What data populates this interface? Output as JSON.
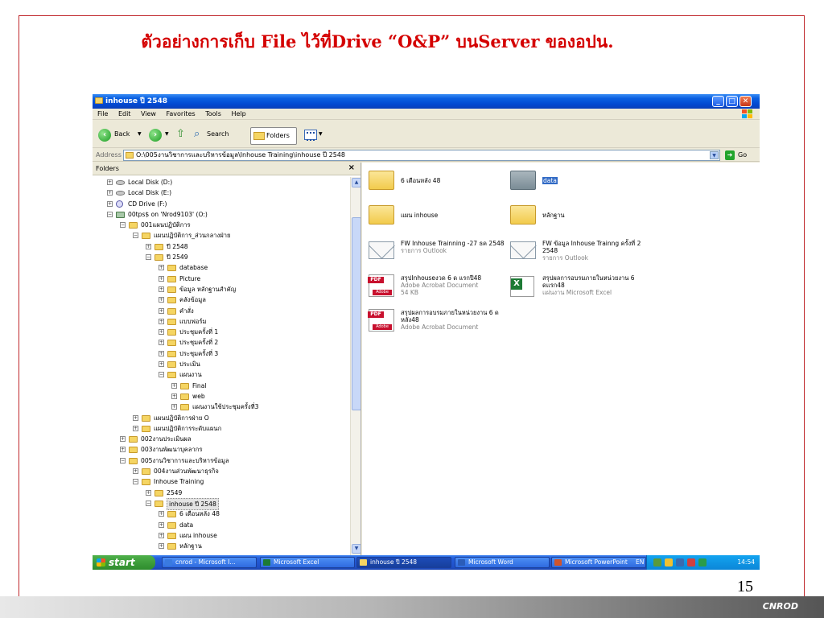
{
  "slide": {
    "title": "ตัวอย่างการเก็บ File ไว้ที่Drive “O&P” บนServer ของอปน.",
    "page_number": "15",
    "brand": "CNROD"
  },
  "window": {
    "title": "inhouse ปี 2548",
    "menu": [
      "File",
      "Edit",
      "View",
      "Favorites",
      "Tools",
      "Help"
    ],
    "toolbar": {
      "back": "Back",
      "search": "Search",
      "folders": "Folders"
    },
    "address": {
      "label": "Address",
      "value": "O:\\005งานวิชาการและบริหารข้อมูล\\Inhouse Training\\inhouse ปี 2548",
      "go": "Go"
    }
  },
  "folders_pane": {
    "header": "Folders",
    "close": "×",
    "items": [
      {
        "label": "Local Disk (D:)",
        "level": 1,
        "exp": "+",
        "icon": "disk-icon"
      },
      {
        "label": "Local Disk (E:)",
        "level": 1,
        "exp": "+",
        "icon": "disk-icon"
      },
      {
        "label": "CD Drive (F:)",
        "level": 1,
        "exp": "+",
        "icon": "cd-icon"
      },
      {
        "label": "00tps$ on 'Nrod9103' (O:)",
        "level": 1,
        "exp": "−",
        "icon": "network-drive-icon"
      },
      {
        "label": "001แผนปฏิบัติการ",
        "level": 2,
        "exp": "−",
        "icon": "folder-icon"
      },
      {
        "label": "แผนปฏิบัติการ_ส่วนกลางฝ่าย",
        "level": 3,
        "exp": "−",
        "icon": "folder-icon"
      },
      {
        "label": "ปี 2548",
        "level": 4,
        "exp": "+",
        "icon": "folder-icon"
      },
      {
        "label": "ปี 2549",
        "level": 4,
        "exp": "−",
        "icon": "folder-icon"
      },
      {
        "label": "database",
        "level": 5,
        "exp": "+",
        "icon": "folder-icon"
      },
      {
        "label": "Picture",
        "level": 5,
        "exp": "+",
        "icon": "folder-icon"
      },
      {
        "label": "ข้อมูล หลักฐานสำคัญ",
        "level": 5,
        "exp": "+",
        "icon": "folder-icon"
      },
      {
        "label": "คลังข้อมูล",
        "level": 5,
        "exp": "+",
        "icon": "folder-icon"
      },
      {
        "label": "คำสั่ง",
        "level": 5,
        "exp": "+",
        "icon": "folder-icon"
      },
      {
        "label": "แบบฟอร์ม",
        "level": 5,
        "exp": "+",
        "icon": "folder-icon"
      },
      {
        "label": "ประชุมครั้งที่ 1",
        "level": 5,
        "exp": "+",
        "icon": "folder-icon"
      },
      {
        "label": "ประชุมครั้งที่ 2",
        "level": 5,
        "exp": "+",
        "icon": "folder-icon"
      },
      {
        "label": "ประชุมครั้งที่ 3",
        "level": 5,
        "exp": "+",
        "icon": "folder-icon"
      },
      {
        "label": "ประเมิน",
        "level": 5,
        "exp": "+",
        "icon": "folder-icon"
      },
      {
        "label": "แผนงาน",
        "level": 5,
        "exp": "−",
        "icon": "folder-icon"
      },
      {
        "label": "Final",
        "level": 6,
        "exp": "+",
        "icon": "folder-icon"
      },
      {
        "label": "web",
        "level": 6,
        "exp": "+",
        "icon": "folder-icon"
      },
      {
        "label": "แผนงานใช้ประชุมครั้งที่3",
        "level": 6,
        "exp": "+",
        "icon": "folder-icon"
      },
      {
        "label": "แผนปฏิบัติการฝ่าย O",
        "level": 3,
        "exp": "+",
        "icon": "folder-icon"
      },
      {
        "label": "แผนปฏิบัติการระดับแผนก",
        "level": 3,
        "exp": "+",
        "icon": "folder-icon"
      },
      {
        "label": "002งานประเมินผล",
        "level": 2,
        "exp": "+",
        "icon": "folder-icon"
      },
      {
        "label": "003งานพัฒนาบุคลากร",
        "level": 2,
        "exp": "+",
        "icon": "folder-icon"
      },
      {
        "label": "005งานวิชาการและบริหารข้อมูล",
        "level": 2,
        "exp": "−",
        "icon": "folder-icon"
      },
      {
        "label": "004งานส่วนพัฒนาธุรกิจ",
        "level": 3,
        "exp": "+",
        "icon": "folder-icon"
      },
      {
        "label": "Inhouse Training",
        "level": 3,
        "exp": "−",
        "icon": "folder-icon"
      },
      {
        "label": "2549",
        "level": 4,
        "exp": "+",
        "icon": "folder-icon"
      },
      {
        "label": "inhouse ปี 2548",
        "level": 4,
        "exp": "−",
        "icon": "folder-icon",
        "selected": true
      },
      {
        "label": "6 เดือนหลัง 48",
        "level": 5,
        "exp": "+",
        "icon": "folder-icon"
      },
      {
        "label": "data",
        "level": 5,
        "exp": "+",
        "icon": "folder-icon"
      },
      {
        "label": "แผน inhouse",
        "level": 5,
        "exp": "+",
        "icon": "folder-icon"
      },
      {
        "label": "หลักฐาน",
        "level": 5,
        "exp": "+",
        "icon": "folder-icon"
      }
    ]
  },
  "files": [
    {
      "name": "6 เดือนหลัง 48",
      "type": "folder",
      "col": 0,
      "row": 0
    },
    {
      "name": "data",
      "type": "folder-gray",
      "col": 1,
      "row": 0,
      "selected": true
    },
    {
      "name": "แผน inhouse",
      "type": "folder",
      "col": 0,
      "row": 1
    },
    {
      "name": "หลักฐาน",
      "type": "folder",
      "col": 1,
      "row": 1
    },
    {
      "name": "FW  Inhouse Trainning -27 ธค 2548",
      "sub": "รายการ Outlook",
      "type": "mail",
      "col": 0,
      "row": 2
    },
    {
      "name": "FW  ข้อมูล Inhouse Trainng ครั้งที่ 2 2548",
      "sub": "รายการ Outlook",
      "type": "mail",
      "col": 1,
      "row": 2
    },
    {
      "name": "สรุปInhouseงวด 6 ด แรกปี48",
      "sub": "Adobe Acrobat Document",
      "sub2": "54 KB",
      "type": "pdf",
      "col": 0,
      "row": 3
    },
    {
      "name": "สรุปผลการอบรมภายในหน่วยงาน 6 ดแรก48",
      "sub": "แผ่นงาน Microsoft Excel",
      "type": "xls",
      "col": 1,
      "row": 3
    },
    {
      "name": "สรุปผลการอบรมภายในหน่วยงาน 6 ดหลัง48",
      "sub": "Adobe Acrobat Document",
      "type": "pdf",
      "col": 0,
      "row": 4
    }
  ],
  "taskbar": {
    "start": "start",
    "tasks": [
      {
        "label": "cnrod - Microsoft I...",
        "color": "#3a7ae0"
      },
      {
        "label": "Microsoft Excel",
        "color": "#1d7a35"
      },
      {
        "label": "inhouse ปี 2548",
        "color": "#f5d563",
        "active": true
      },
      {
        "label": "Microsoft Word",
        "color": "#2b5cb8"
      },
      {
        "label": "Microsoft PowerPoint",
        "color": "#d0542c"
      }
    ],
    "lang": "EN",
    "clock": "14:54"
  }
}
